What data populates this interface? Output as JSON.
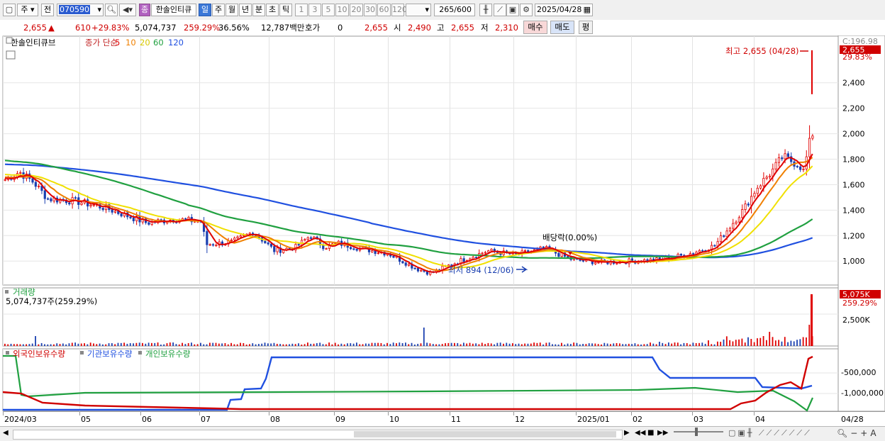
{
  "toolbar": {
    "market_label": "주",
    "prev_label": "전",
    "code_value": "070590",
    "stock_badge": "종",
    "stock_name": "한솔인티큐",
    "periods": [
      "일",
      "주",
      "월",
      "년",
      "분",
      "초",
      "틱"
    ],
    "active_period": "일",
    "intervals": [
      "1",
      "3",
      "5",
      "10",
      "20",
      "30",
      "60",
      "120"
    ],
    "count_value": "265",
    "count_total": "/600",
    "date_value": "2025/04/28"
  },
  "quote": {
    "price": "2,655",
    "change": "610",
    "change_pct": "+29.83%",
    "volume": "5,074,737",
    "volume_pct": "259.29%",
    "turnover": "36.56%",
    "amount": "12,787백만",
    "hoga_label": "호가",
    "hoga_value": "0",
    "hoga_price": "2,655",
    "open_label": "시",
    "open_value": "2,490",
    "high_label": "고",
    "high_value": "2,655",
    "low_label": "저",
    "low_value": "2,310",
    "buy_label": "매수",
    "sell_label": "매도",
    "avg_label": "평"
  },
  "price_panel": {
    "legend_name": "한솔인티큐브",
    "legend_type": "종가 단순",
    "ma_labels": [
      "5",
      "10",
      "20",
      "60",
      "120"
    ],
    "ma_colors": [
      "#e00000",
      "#f08000",
      "#f0e000",
      "#20a040",
      "#2050e0"
    ],
    "corner_label": "C:196.98",
    "last_price_box": "2,655",
    "last_pct": "29.83%",
    "high_annotation": "최고 2,655 (04/28)",
    "low_annotation": "최저 894 (12/06)",
    "dividend_annotation": "배당락(0.00%)",
    "y_ticks": [
      "2,400",
      "2,200",
      "2,000",
      "1,800",
      "1,600",
      "1,400",
      "1,200",
      "1,000"
    ]
  },
  "volume_panel": {
    "title": "거래량",
    "summary": "5,074,737주(259.29%)",
    "last_box": "5,075K",
    "last_pct": "259.29%",
    "tick": "2,500K"
  },
  "holding_panel": {
    "legend": [
      {
        "name": "외국인보유수량",
        "color": "#d00000"
      },
      {
        "name": "기관보유수량",
        "color": "#2050e0"
      },
      {
        "name": "개인보유수량",
        "color": "#20a040"
      }
    ],
    "ticks": [
      "-500,000",
      "-1,000,000"
    ]
  },
  "x_axis": {
    "labels": [
      "2024/03",
      "05",
      "06",
      "07",
      "08",
      "09",
      "10",
      "11",
      "12",
      "2025/01",
      "02",
      "03",
      "04"
    ],
    "end_label": "04/28"
  },
  "chart_data": {
    "type": "line",
    "title": "한솔인티큐브",
    "x": [
      "2024/03",
      "2024/05",
      "2024/06",
      "2024/07",
      "2024/08",
      "2024/09",
      "2024/10",
      "2024/11",
      "2024/12",
      "2025/01",
      "2025/02",
      "2025/03",
      "2025/04",
      "04/28"
    ],
    "series": [
      {
        "name": "5",
        "values": [
          1650,
          1480,
          1420,
          1320,
          1180,
          1090,
          1130,
          1150,
          920,
          1040,
          1010,
          1060,
          1820,
          1980
        ]
      },
      {
        "name": "10",
        "values": [
          1660,
          1490,
          1430,
          1330,
          1200,
          1100,
          1130,
          1140,
          940,
          1040,
          1010,
          1050,
          1750,
          1900
        ]
      },
      {
        "name": "20",
        "values": [
          1680,
          1510,
          1440,
          1350,
          1230,
          1120,
          1140,
          1140,
          980,
          1030,
          1010,
          1040,
          1600,
          1800
        ]
      },
      {
        "name": "60",
        "values": [
          1790,
          1620,
          1500,
          1390,
          1310,
          1230,
          1190,
          1170,
          1110,
          1040,
          1000,
          1000,
          1130,
          1340
        ]
      },
      {
        "name": "120",
        "values": [
          1760,
          1710,
          1650,
          1560,
          1440,
          1340,
          1270,
          1220,
          1140,
          1080,
          1040,
          1050,
          1090,
          1190
        ]
      }
    ],
    "ylim": [
      890,
      2660
    ],
    "high": {
      "value": 2655,
      "label": "최고 2,655 (04/28)"
    },
    "low": {
      "value": 894,
      "label": "최저 894 (12/06)"
    }
  }
}
